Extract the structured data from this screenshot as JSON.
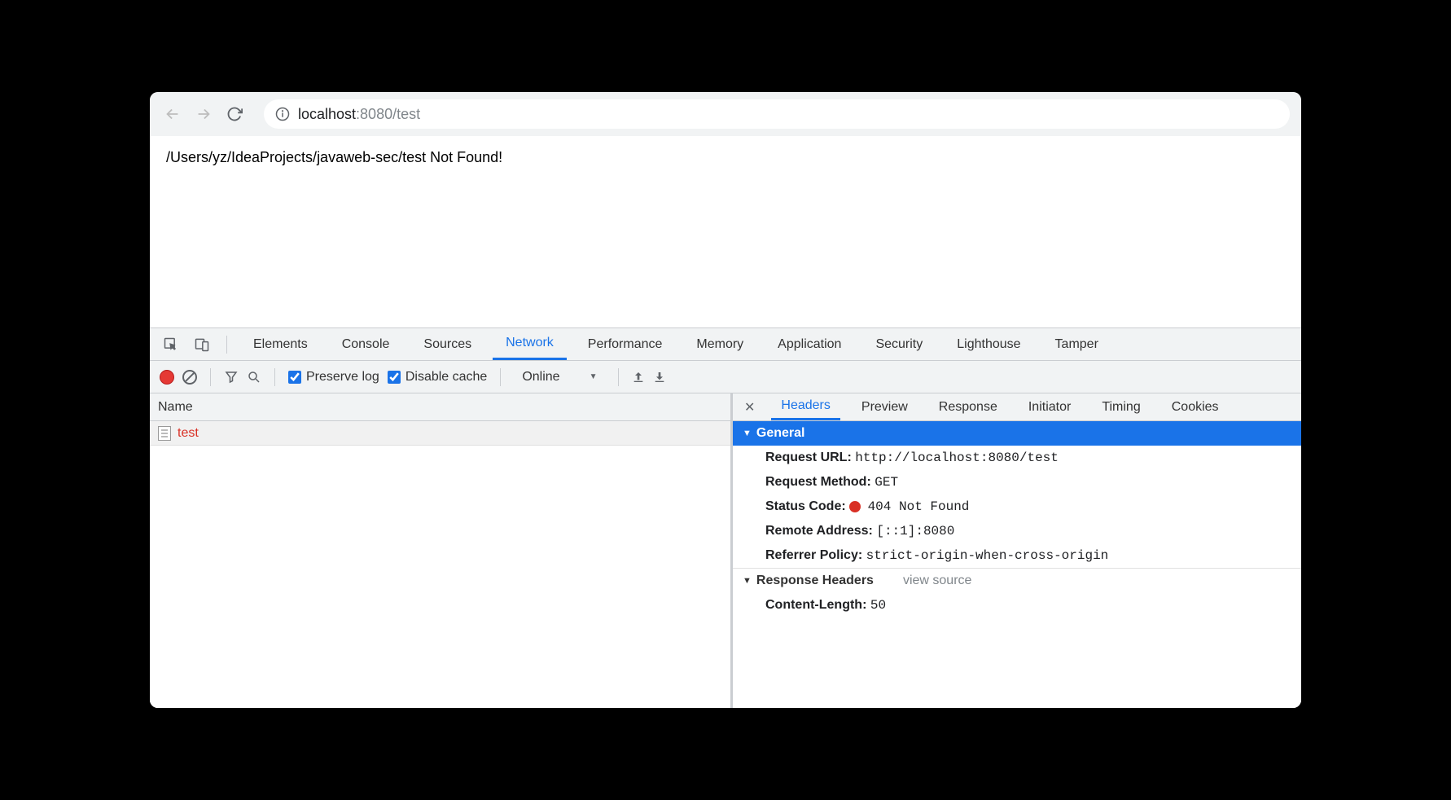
{
  "addressBar": {
    "host": "localhost",
    "port": ":8080",
    "path": "/test"
  },
  "pageContent": "/Users/yz/IdeaProjects/javaweb-sec/test Not Found!",
  "devtools": {
    "tabs": [
      "Elements",
      "Console",
      "Sources",
      "Network",
      "Performance",
      "Memory",
      "Application",
      "Security",
      "Lighthouse",
      "Tamper"
    ],
    "activeTab": "Network",
    "controls": {
      "preserveLog": "Preserve log",
      "disableCache": "Disable cache",
      "throttling": "Online"
    },
    "namePanel": {
      "header": "Name",
      "requests": [
        {
          "name": "test"
        }
      ]
    },
    "detail": {
      "tabs": [
        "Headers",
        "Preview",
        "Response",
        "Initiator",
        "Timing",
        "Cookies"
      ],
      "activeTab": "Headers",
      "general": {
        "title": "General",
        "requestUrlLabel": "Request URL:",
        "requestUrl": "http://localhost:8080/test",
        "requestMethodLabel": "Request Method:",
        "requestMethod": "GET",
        "statusCodeLabel": "Status Code:",
        "statusCode": "404 Not Found",
        "remoteAddressLabel": "Remote Address:",
        "remoteAddress": "[::1]:8080",
        "referrerPolicyLabel": "Referrer Policy:",
        "referrerPolicy": "strict-origin-when-cross-origin"
      },
      "responseHeaders": {
        "title": "Response Headers",
        "viewSource": "view source",
        "contentLengthLabel": "Content-Length:",
        "contentLength": "50"
      }
    }
  }
}
